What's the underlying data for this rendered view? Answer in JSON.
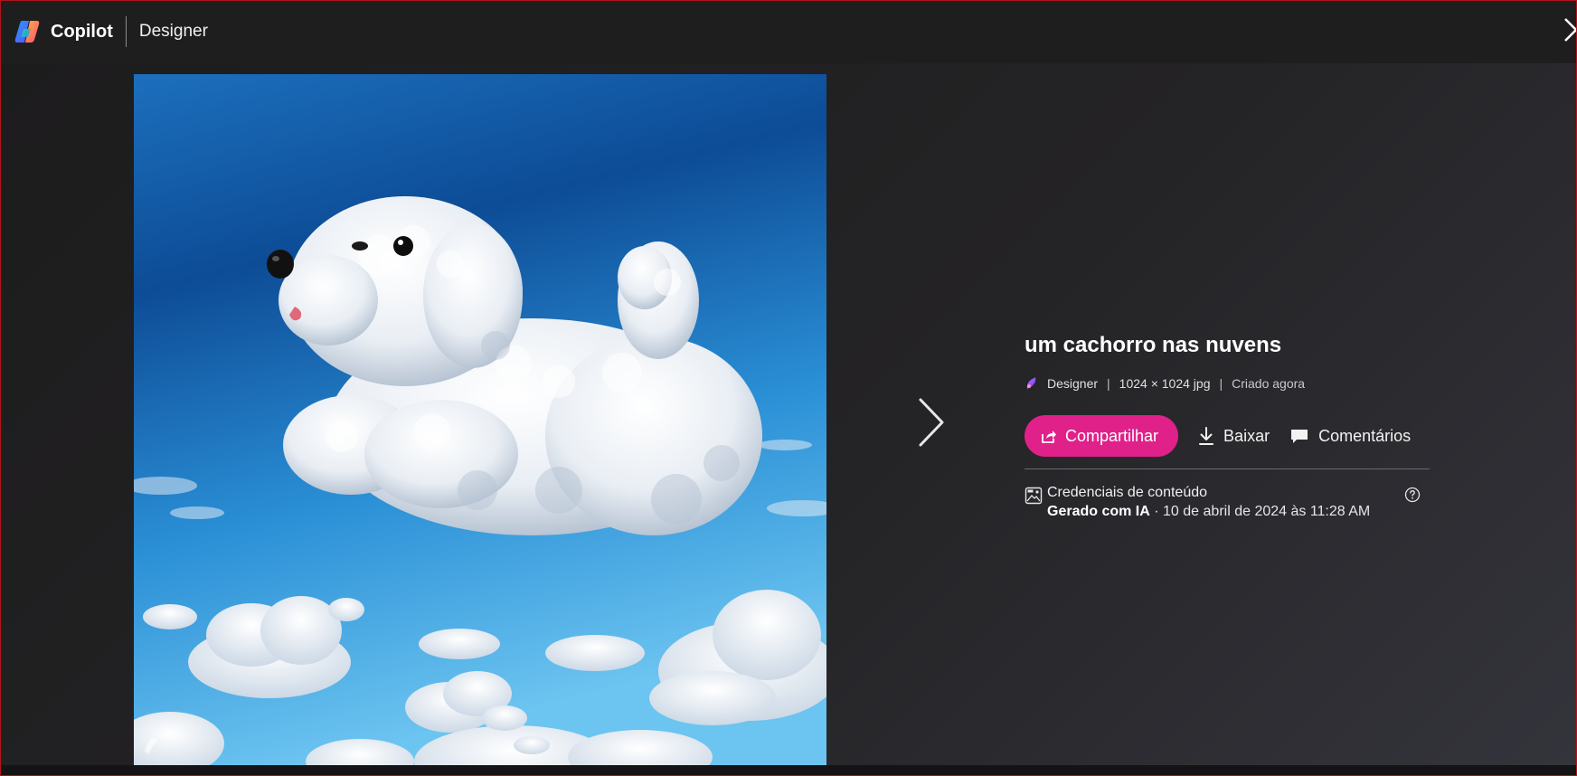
{
  "header": {
    "app_name": "Copilot",
    "product_name": "Designer"
  },
  "image": {
    "description_icon": "designer-watermark-icon"
  },
  "details": {
    "title": "um cachorro nas nuvens",
    "source": "Designer",
    "dimensions": "1024 × 1024 jpg",
    "created": "Criado agora",
    "meta_separator": "|"
  },
  "actions": {
    "share_label": "Compartilhar",
    "download_label": "Baixar",
    "comments_label": "Comentários"
  },
  "credentials": {
    "label": "Credenciais de conteúdo",
    "generated_label": "Gerado com IA",
    "date_text": " · 10 de abril de 2024 às 11:28 AM"
  },
  "colors": {
    "accent": "#e0218a",
    "background": "#1c1b1c"
  }
}
